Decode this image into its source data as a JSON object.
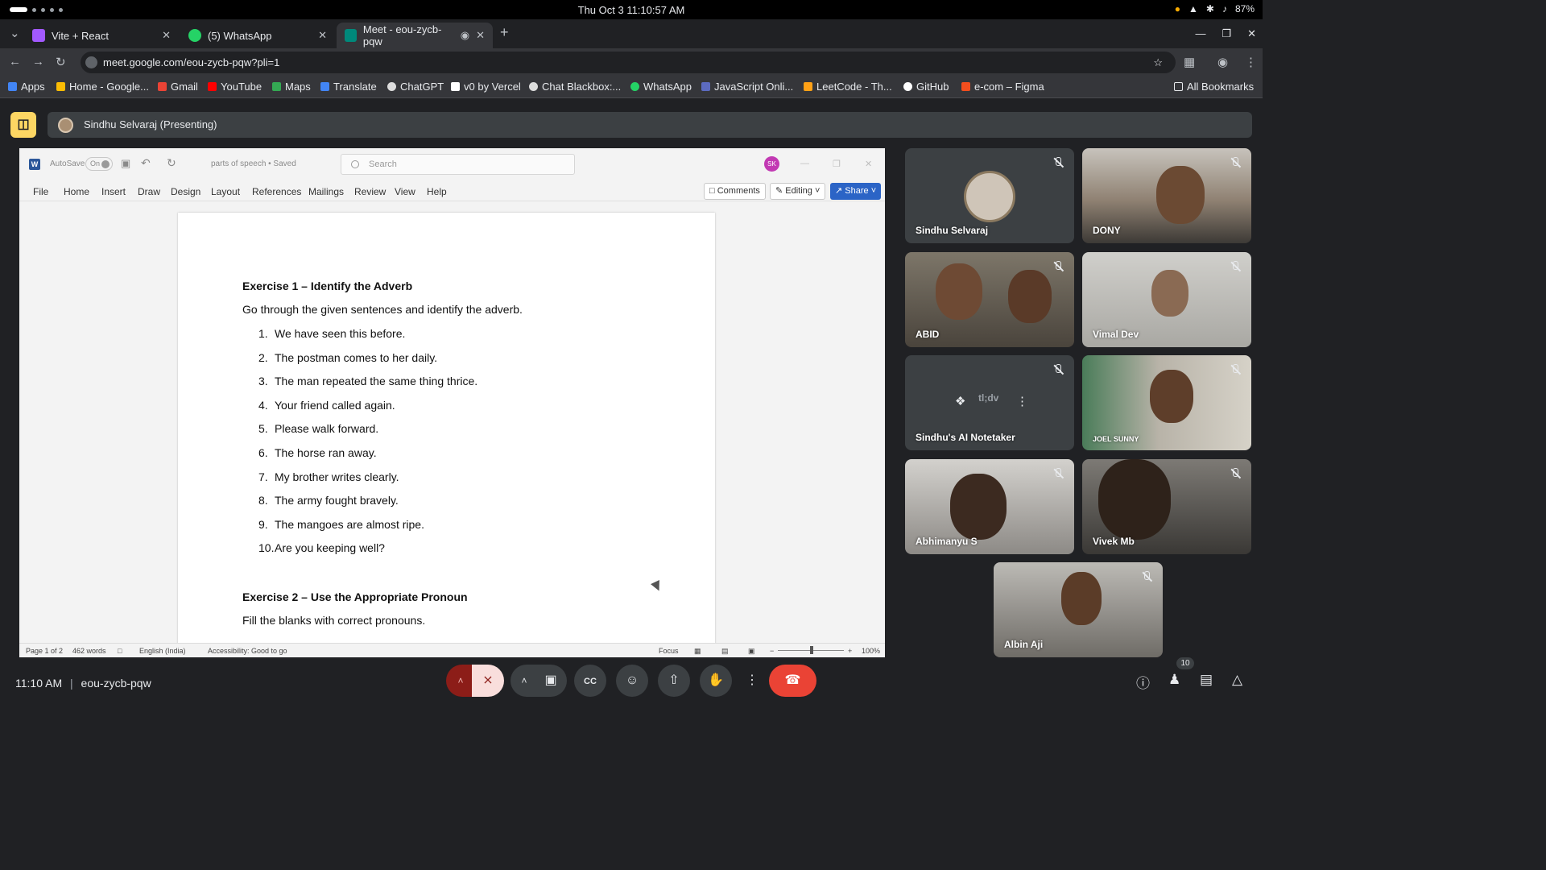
{
  "system": {
    "datetime": "Thu Oct 3  11:10:57 AM",
    "battery": "87%"
  },
  "tabs": [
    {
      "title": "Vite + React",
      "favcolor": "#a259ff"
    },
    {
      "title": "(5) WhatsApp",
      "favcolor": "#25d366"
    },
    {
      "title": "Meet - eou-zycb-pqw",
      "favcolor": "#00897b"
    }
  ],
  "url": "meet.google.com/eou-zycb-pqw?pli=1",
  "bookmarks": [
    {
      "label": "Apps",
      "color": "#4285f4"
    },
    {
      "label": "Home - Google...",
      "color": "#fbbc04"
    },
    {
      "label": "Gmail",
      "color": "#ea4335"
    },
    {
      "label": "YouTube",
      "color": "#ff0000"
    },
    {
      "label": "Maps",
      "color": "#34a853"
    },
    {
      "label": "Translate",
      "color": "#4285f4"
    },
    {
      "label": "ChatGPT",
      "color": "#dddddd"
    },
    {
      "label": "v0 by Vercel",
      "color": "#ffffff"
    },
    {
      "label": "Chat Blackbox:...",
      "color": "#dddddd"
    },
    {
      "label": "WhatsApp",
      "color": "#25d366"
    },
    {
      "label": "JavaScript Onli...",
      "color": "#5c6bc0"
    },
    {
      "label": "LeetCode - Th...",
      "color": "#ffa116"
    },
    {
      "label": "GitHub",
      "color": "#ffffff"
    },
    {
      "label": "e-com – Figma",
      "color": "#f24e1e"
    }
  ],
  "all_bookmarks": "All Bookmarks",
  "presenting": "Sindhu Selvaraj (Presenting)",
  "word": {
    "autosave": "AutoSave",
    "toggle": "On",
    "doc_title": "parts of speech • Saved",
    "search": "Search",
    "avatar": "SK",
    "menu": [
      "File",
      "Home",
      "Insert",
      "Draw",
      "Design",
      "Layout",
      "References",
      "Mailings",
      "Review",
      "View",
      "Help"
    ],
    "comments": "Comments",
    "editing": "Editing",
    "share": "Share",
    "status": {
      "page": "Page 1 of 2",
      "words": "462 words",
      "lang": "English (India)",
      "access": "Accessibility: Good to go",
      "focus": "Focus",
      "zoom": "100%"
    }
  },
  "document": {
    "ex1_title": "Exercise 1 – Identify the Adverb",
    "ex1_instruction": "Go through the given sentences and identify the adverb.",
    "ex1_items": [
      {
        "n": "1.",
        "t": "We have seen this before."
      },
      {
        "n": "2.",
        "t": "The postman comes to her daily."
      },
      {
        "n": "3.",
        "t": "The man repeated the same thing thrice."
      },
      {
        "n": "4.",
        "t": "Your friend called again."
      },
      {
        "n": "5.",
        "t": "Please walk forward."
      },
      {
        "n": "6.",
        "t": "The horse ran away."
      },
      {
        "n": "7.",
        "t": "My brother writes clearly."
      },
      {
        "n": "8.",
        "t": "The army fought bravely."
      },
      {
        "n": "9.",
        "t": "The mangoes are almost ripe."
      },
      {
        "n": "10.",
        "t": "Are you keeping well?"
      }
    ],
    "ex2_title": "Exercise 2 – Use the Appropriate Pronoun",
    "ex2_instruction": "Fill the blanks with correct pronouns."
  },
  "participants": [
    {
      "name": "Sindhu Selvaraj",
      "bg": "#3c4043"
    },
    {
      "name": "DONY",
      "bg": "#9e8f7c"
    },
    {
      "name": "ABID",
      "bg": "#6b6358"
    },
    {
      "name": "Vimal Dev",
      "bg": "#a9a8a3"
    },
    {
      "name": "Sindhu's AI Notetaker",
      "bg": "#3c4043"
    },
    {
      "name": "JOEL SUNNY",
      "bg": "#8a8070"
    },
    {
      "name": "Abhimanyu S",
      "bg": "#8d8a86"
    },
    {
      "name": "Vivek Mb",
      "bg": "#5e5a55"
    },
    {
      "name": "Albin Aji",
      "bg": "#7b7873"
    }
  ],
  "notetaker_label": "tl;dv",
  "meeting": {
    "time": "11:10 AM",
    "code": "eou-zycb-pqw",
    "people_count": "10"
  },
  "colors": {
    "meet_bg": "#202124",
    "end_call": "#ea4335",
    "present_icon": "#fdd663",
    "word_blue": "#2b579a"
  }
}
